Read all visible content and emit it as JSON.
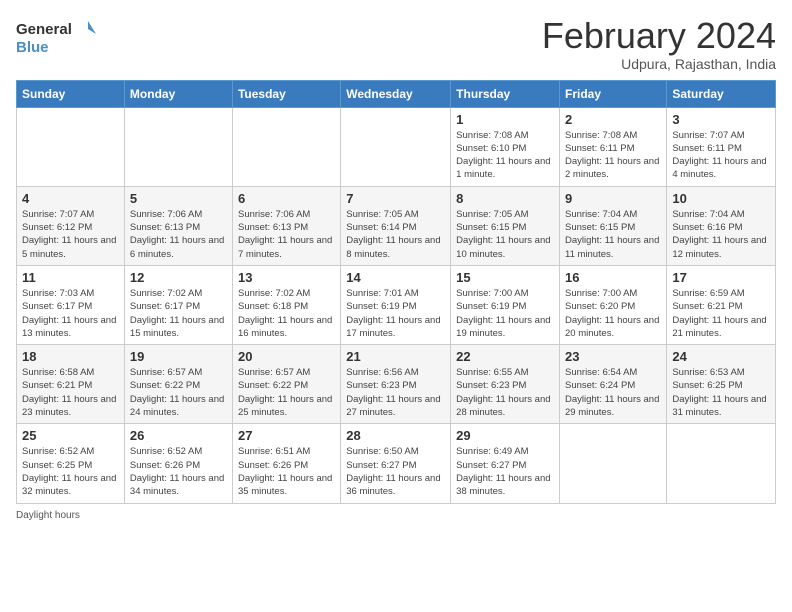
{
  "header": {
    "logo_line1": "General",
    "logo_line2": "Blue",
    "month_title": "February 2024",
    "subtitle": "Udpura, Rajasthan, India"
  },
  "days_of_week": [
    "Sunday",
    "Monday",
    "Tuesday",
    "Wednesday",
    "Thursday",
    "Friday",
    "Saturday"
  ],
  "footer": {
    "daylight_label": "Daylight hours"
  },
  "weeks": [
    [
      {
        "day": "",
        "info": ""
      },
      {
        "day": "",
        "info": ""
      },
      {
        "day": "",
        "info": ""
      },
      {
        "day": "",
        "info": ""
      },
      {
        "day": "1",
        "info": "Sunrise: 7:08 AM\nSunset: 6:10 PM\nDaylight: 11 hours and 1 minute."
      },
      {
        "day": "2",
        "info": "Sunrise: 7:08 AM\nSunset: 6:11 PM\nDaylight: 11 hours and 2 minutes."
      },
      {
        "day": "3",
        "info": "Sunrise: 7:07 AM\nSunset: 6:11 PM\nDaylight: 11 hours and 4 minutes."
      }
    ],
    [
      {
        "day": "4",
        "info": "Sunrise: 7:07 AM\nSunset: 6:12 PM\nDaylight: 11 hours and 5 minutes."
      },
      {
        "day": "5",
        "info": "Sunrise: 7:06 AM\nSunset: 6:13 PM\nDaylight: 11 hours and 6 minutes."
      },
      {
        "day": "6",
        "info": "Sunrise: 7:06 AM\nSunset: 6:13 PM\nDaylight: 11 hours and 7 minutes."
      },
      {
        "day": "7",
        "info": "Sunrise: 7:05 AM\nSunset: 6:14 PM\nDaylight: 11 hours and 8 minutes."
      },
      {
        "day": "8",
        "info": "Sunrise: 7:05 AM\nSunset: 6:15 PM\nDaylight: 11 hours and 10 minutes."
      },
      {
        "day": "9",
        "info": "Sunrise: 7:04 AM\nSunset: 6:15 PM\nDaylight: 11 hours and 11 minutes."
      },
      {
        "day": "10",
        "info": "Sunrise: 7:04 AM\nSunset: 6:16 PM\nDaylight: 11 hours and 12 minutes."
      }
    ],
    [
      {
        "day": "11",
        "info": "Sunrise: 7:03 AM\nSunset: 6:17 PM\nDaylight: 11 hours and 13 minutes."
      },
      {
        "day": "12",
        "info": "Sunrise: 7:02 AM\nSunset: 6:17 PM\nDaylight: 11 hours and 15 minutes."
      },
      {
        "day": "13",
        "info": "Sunrise: 7:02 AM\nSunset: 6:18 PM\nDaylight: 11 hours and 16 minutes."
      },
      {
        "day": "14",
        "info": "Sunrise: 7:01 AM\nSunset: 6:19 PM\nDaylight: 11 hours and 17 minutes."
      },
      {
        "day": "15",
        "info": "Sunrise: 7:00 AM\nSunset: 6:19 PM\nDaylight: 11 hours and 19 minutes."
      },
      {
        "day": "16",
        "info": "Sunrise: 7:00 AM\nSunset: 6:20 PM\nDaylight: 11 hours and 20 minutes."
      },
      {
        "day": "17",
        "info": "Sunrise: 6:59 AM\nSunset: 6:21 PM\nDaylight: 11 hours and 21 minutes."
      }
    ],
    [
      {
        "day": "18",
        "info": "Sunrise: 6:58 AM\nSunset: 6:21 PM\nDaylight: 11 hours and 23 minutes."
      },
      {
        "day": "19",
        "info": "Sunrise: 6:57 AM\nSunset: 6:22 PM\nDaylight: 11 hours and 24 minutes."
      },
      {
        "day": "20",
        "info": "Sunrise: 6:57 AM\nSunset: 6:22 PM\nDaylight: 11 hours and 25 minutes."
      },
      {
        "day": "21",
        "info": "Sunrise: 6:56 AM\nSunset: 6:23 PM\nDaylight: 11 hours and 27 minutes."
      },
      {
        "day": "22",
        "info": "Sunrise: 6:55 AM\nSunset: 6:23 PM\nDaylight: 11 hours and 28 minutes."
      },
      {
        "day": "23",
        "info": "Sunrise: 6:54 AM\nSunset: 6:24 PM\nDaylight: 11 hours and 29 minutes."
      },
      {
        "day": "24",
        "info": "Sunrise: 6:53 AM\nSunset: 6:25 PM\nDaylight: 11 hours and 31 minutes."
      }
    ],
    [
      {
        "day": "25",
        "info": "Sunrise: 6:52 AM\nSunset: 6:25 PM\nDaylight: 11 hours and 32 minutes."
      },
      {
        "day": "26",
        "info": "Sunrise: 6:52 AM\nSunset: 6:26 PM\nDaylight: 11 hours and 34 minutes."
      },
      {
        "day": "27",
        "info": "Sunrise: 6:51 AM\nSunset: 6:26 PM\nDaylight: 11 hours and 35 minutes."
      },
      {
        "day": "28",
        "info": "Sunrise: 6:50 AM\nSunset: 6:27 PM\nDaylight: 11 hours and 36 minutes."
      },
      {
        "day": "29",
        "info": "Sunrise: 6:49 AM\nSunset: 6:27 PM\nDaylight: 11 hours and 38 minutes."
      },
      {
        "day": "",
        "info": ""
      },
      {
        "day": "",
        "info": ""
      }
    ]
  ]
}
